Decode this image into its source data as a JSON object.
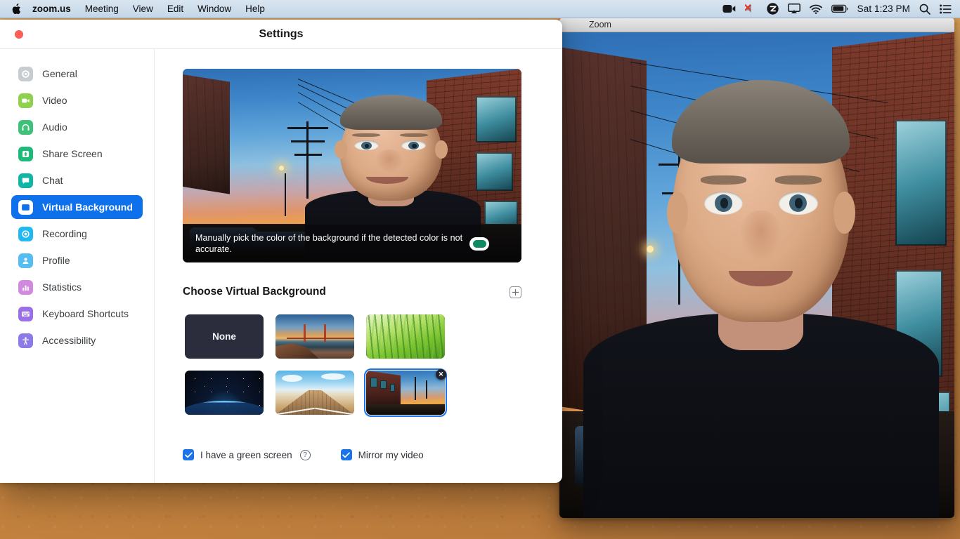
{
  "menubar": {
    "apple_glyph": "",
    "items": [
      {
        "label": "zoom.us",
        "bold": true
      },
      {
        "label": "Meeting",
        "bold": false
      },
      {
        "label": "View",
        "bold": false
      },
      {
        "label": "Edit",
        "bold": false
      },
      {
        "label": "Window",
        "bold": false
      },
      {
        "label": "Help",
        "bold": false
      }
    ],
    "status_icons": [
      "video-camera-icon",
      "speaker-muted-icon",
      "zoom-logo-icon",
      "airplay-icon",
      "wifi-icon",
      "battery-icon"
    ],
    "time": "Sat 1:23 PM",
    "search_icon": "search-icon",
    "control_center_icon": "control-center-icon"
  },
  "background_window": {
    "title": "Zoom"
  },
  "settings": {
    "title": "Settings",
    "close_button_label": "Close",
    "sidebar": {
      "items": [
        {
          "label": "General",
          "icon": "gear-icon",
          "color": "#c7ccd1",
          "selected": false
        },
        {
          "label": "Video",
          "icon": "camera-icon",
          "color": "#8fd14f",
          "selected": false
        },
        {
          "label": "Audio",
          "icon": "headphones-icon",
          "color": "#3fc17a",
          "selected": false
        },
        {
          "label": "Share Screen",
          "icon": "upload-icon",
          "color": "#1dbb77",
          "selected": false
        },
        {
          "label": "Chat",
          "icon": "chat-bubble-icon",
          "color": "#11b5a6",
          "selected": false
        },
        {
          "label": "Virtual Background",
          "icon": "person-card-icon",
          "color": "#ffffff",
          "selected": true
        },
        {
          "label": "Recording",
          "icon": "record-icon",
          "color": "#22b8f0",
          "selected": false
        },
        {
          "label": "Profile",
          "icon": "person-icon",
          "color": "#56bdf0",
          "selected": false
        },
        {
          "label": "Statistics",
          "icon": "bar-chart-icon",
          "color": "#d28ae0",
          "selected": false
        },
        {
          "label": "Keyboard Shortcuts",
          "icon": "keyboard-icon",
          "color": "#9b6fe8",
          "selected": false
        },
        {
          "label": "Accessibility",
          "icon": "accessibility-icon",
          "color": "#8b7ae8",
          "selected": false
        }
      ]
    },
    "preview": {
      "banner_text": "Manually pick the color of the background if the detected color is not accurate.",
      "green_screen_swatch_color": "#0f8a63"
    },
    "choose_section": {
      "title": "Choose Virtual Background",
      "add_button_icon": "plus-icon",
      "thumbnails": [
        {
          "name": "None",
          "art": "none",
          "selected": false,
          "deletable": false
        },
        {
          "name": "Golden Gate Bridge",
          "art": "bridge",
          "selected": false,
          "deletable": false
        },
        {
          "name": "Grass",
          "art": "grass",
          "selected": false,
          "deletable": false
        },
        {
          "name": "Earth from Space",
          "art": "earth",
          "selected": false,
          "deletable": false
        },
        {
          "name": "Wooden Pier",
          "art": "pier",
          "selected": false,
          "deletable": false
        },
        {
          "name": "City Street Sunset",
          "art": "street",
          "selected": true,
          "deletable": true
        }
      ],
      "delete_badge_glyph": "✕"
    },
    "footer": {
      "green_screen": {
        "label": "I have a green screen",
        "checked": true
      },
      "help_glyph": "?",
      "mirror_video": {
        "label": "Mirror my video",
        "checked": true
      }
    }
  }
}
